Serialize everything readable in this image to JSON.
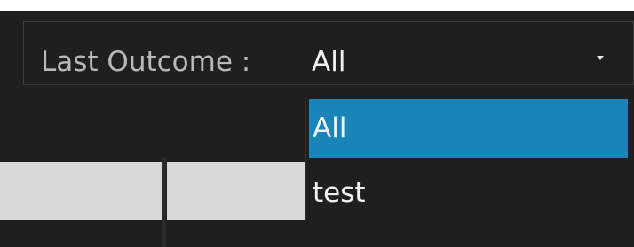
{
  "filter": {
    "label": "Last Outcome :",
    "selected_value": "All",
    "caret_icon": "chevron-down-icon"
  },
  "dropdown": {
    "options": [
      "All",
      "test"
    ],
    "highlighted_index": 0,
    "highlight_color": "#1a84b8"
  },
  "colors": {
    "background": "#1f1f1f",
    "text": "#f1f1f1",
    "label_text": "#b9b9b9",
    "grid_cell": "#d9d9d9"
  }
}
